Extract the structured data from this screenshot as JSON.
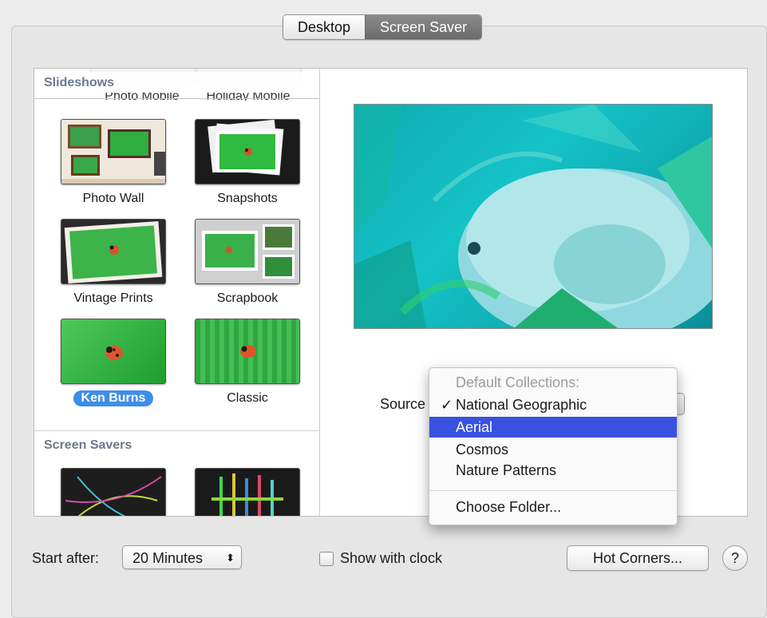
{
  "tabs": [
    {
      "label": "Desktop",
      "active": false
    },
    {
      "label": "Screen Saver",
      "active": true
    }
  ],
  "slideshows": {
    "header": "Slideshows",
    "clipped_items": [
      "Photo Mobile",
      "Holiday Mobile"
    ],
    "items": [
      {
        "label": "Photo Wall",
        "selected": false
      },
      {
        "label": "Snapshots",
        "selected": false
      },
      {
        "label": "Vintage Prints",
        "selected": false
      },
      {
        "label": "Scrapbook",
        "selected": false
      },
      {
        "label": "Ken Burns",
        "selected": true
      },
      {
        "label": "Classic",
        "selected": false
      }
    ]
  },
  "screen_savers": {
    "header": "Screen Savers"
  },
  "source": {
    "label": "Source",
    "menu": {
      "header": "Default Collections:",
      "checkmark": "✓",
      "items": [
        "National Geographic",
        "Aerial",
        "Cosmos",
        "Nature Patterns"
      ],
      "checked": "National Geographic",
      "highlighted": "Aerial",
      "choose_folder": "Choose Folder..."
    }
  },
  "bottom": {
    "start_after_label": "Start after:",
    "start_after_value": "20 Minutes",
    "stepper_glyph": "⬍",
    "show_clock_label": "Show with clock",
    "show_clock_checked": false,
    "hot_corners_label": "Hot Corners...",
    "help_label": "?"
  },
  "colors": {
    "selection_blue": "#3d8ee6",
    "menu_highlight": "#3951e0",
    "section_header": "#6a7a8d"
  }
}
